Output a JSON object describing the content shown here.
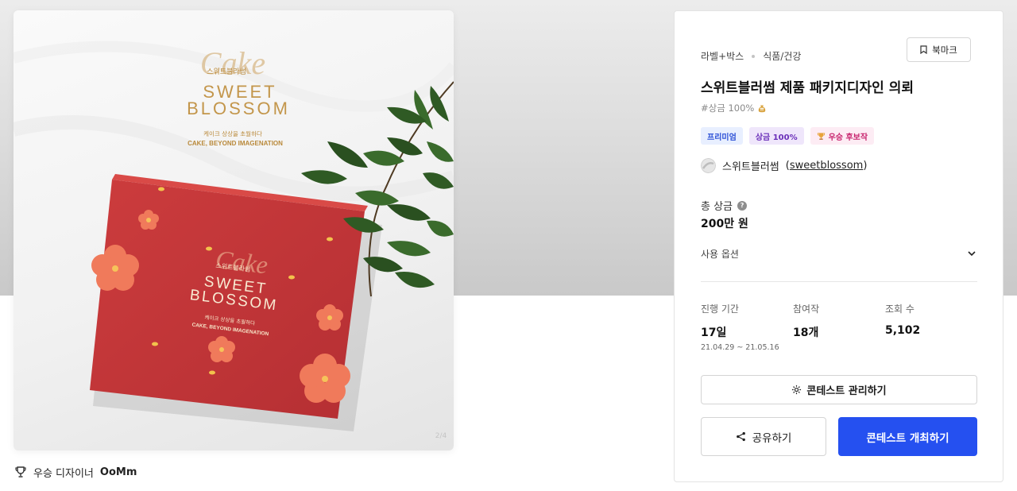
{
  "hero": {
    "top_brand": "스위트블라썸",
    "script_word": "Cake",
    "sweet": "SWEET",
    "blossom": "BLOSSOM",
    "tagline_ko": "케이크 상상을 초월하다",
    "tagline_en": "CAKE, BEYOND IMAGENATION",
    "box_brand": "스위트블라썸",
    "box_script": "Cake",
    "box_sweet": "SWEET",
    "box_blossom": "BLOSSOM",
    "box_tagline_ko": "케이크 상상을 초월하다",
    "box_tagline_en": "CAKE, BEYOND IMAGENATION",
    "watermark": "2/4",
    "colors": {
      "box": "#c8383a",
      "gold": "#c99a4e",
      "flower": "#f07a5b",
      "leaf": "#2f5a24"
    }
  },
  "designer": {
    "icon": "trophy-icon",
    "prefix": "우승 디자이너",
    "name": "OoMm"
  },
  "panel": {
    "category_main": "라벨+박스",
    "category_sub": "식품/건강",
    "bookmark_label": "북마크",
    "title": "스위트블러썸 제품 패키지디자인 의뢰",
    "tag": "#상금 100%",
    "badges": [
      {
        "label": "프리미엄"
      },
      {
        "label": "상금 100%"
      },
      {
        "label": "우승 후보작",
        "icon": "trophy-icon"
      }
    ],
    "owner_name": "스위트블러썸",
    "owner_handle": "sweetblossom",
    "prize_label": "총 상금",
    "prize_value": "200만 원",
    "usage_label": "사용 옵션",
    "stats": [
      {
        "label": "진행 기간",
        "value": "17일",
        "range": "21.04.29  ~  21.05.16"
      },
      {
        "label": "참여작",
        "value": "18개"
      },
      {
        "label": "조회 수",
        "value": "5,102"
      }
    ],
    "manage_label": "콘테스트 관리하기",
    "share_label": "공유하기",
    "host_label": "콘테스트 개최하기",
    "accent_color": "#2550f0"
  }
}
